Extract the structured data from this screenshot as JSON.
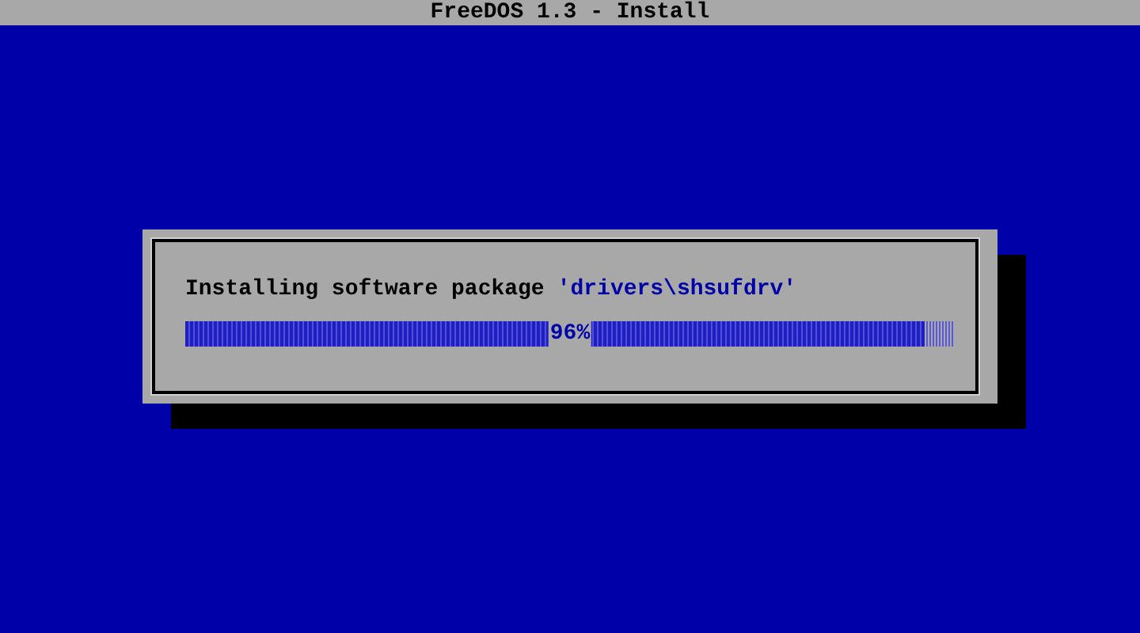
{
  "window": {
    "title": "FreeDOS 1.3 - Install"
  },
  "dialog": {
    "message": "Installing software package",
    "package": "'drivers\\shsufdrv'",
    "progress": {
      "level": 0.96,
      "reading": "96%"
    }
  }
}
